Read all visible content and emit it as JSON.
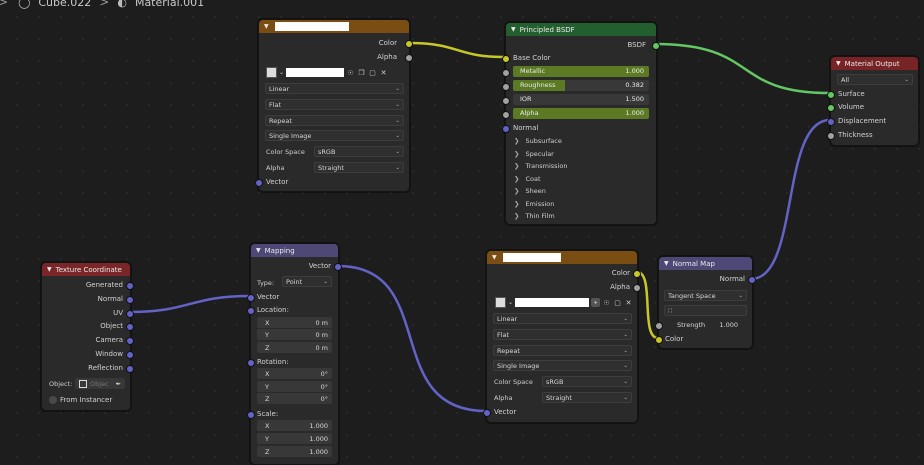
{
  "breadcrumb": {
    "object": "Cube.022",
    "material": "Material.001",
    "sep": ">"
  },
  "image_tex_1": {
    "out_color": "Color",
    "out_alpha": "Alpha",
    "interpolation": "Linear",
    "projection": "Flat",
    "extension": "Repeat",
    "source": "Single Image",
    "color_space_label": "Color Space",
    "color_space": "sRGB",
    "alpha_label": "Alpha",
    "alpha_mode": "Straight",
    "in_vector": "Vector"
  },
  "bsdf": {
    "title": "Principled BSDF",
    "out": "BSDF",
    "base_color": "Base Color",
    "metallic": {
      "label": "Metallic",
      "value": "1.000",
      "fraction": 1.0
    },
    "roughness": {
      "label": "Roughness",
      "value": "0.382",
      "fraction": 0.382
    },
    "ior": {
      "label": "IOR",
      "value": "1.500"
    },
    "alpha": {
      "label": "Alpha",
      "value": "1.000",
      "fraction": 1.0
    },
    "normal": "Normal",
    "panels": [
      "Subsurface",
      "Specular",
      "Transmission",
      "Coat",
      "Sheen",
      "Emission",
      "Thin Film"
    ]
  },
  "material_output": {
    "title": "Material Output",
    "target": "All",
    "inputs": [
      "Surface",
      "Volume",
      "Displacement",
      "Thickness"
    ]
  },
  "tex_coord": {
    "title": "Texture Coordinate",
    "outputs": [
      "Generated",
      "Normal",
      "UV",
      "Object",
      "Camera",
      "Window",
      "Reflection"
    ],
    "object_label": "Object:",
    "object_placeholder": "Objec",
    "from_instancer": "From Instancer"
  },
  "mapping": {
    "title": "Mapping",
    "out": "Vector",
    "type_label": "Type:",
    "type": "Point",
    "in_vector": "Vector",
    "location_label": "Location:",
    "location": {
      "x": "0 m",
      "y": "0 m",
      "z": "0 m"
    },
    "rotation_label": "Rotation:",
    "rotation": {
      "x": "0°",
      "y": "0°",
      "z": "0°"
    },
    "scale_label": "Scale:",
    "scale": {
      "x": "1.000",
      "y": "1.000",
      "z": "1.000"
    },
    "axis": {
      "x": "X",
      "y": "Y",
      "z": "Z"
    }
  },
  "image_tex_2": {
    "out_color": "Color",
    "out_alpha": "Alpha",
    "interpolation": "Linear",
    "projection": "Flat",
    "extension": "Repeat",
    "source": "Single Image",
    "color_space_label": "Color Space",
    "color_space": "sRGB",
    "alpha_label": "Alpha",
    "alpha_mode": "Straight",
    "in_vector": "Vector"
  },
  "normal_map": {
    "title": "Normal Map",
    "out": "Normal",
    "space": "Tangent Space",
    "strength_label": "Strength",
    "strength": "1.000",
    "in_color": "Color"
  },
  "colors": {
    "yellow": "#c7c729",
    "green": "#63c763",
    "purple": "#6363c7",
    "grey": "#a1a1a1"
  }
}
